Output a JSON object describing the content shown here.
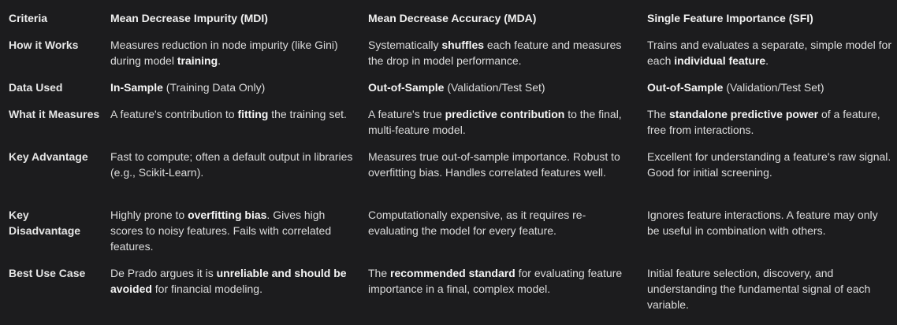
{
  "header": [
    "Criteria",
    "Mean Decrease Impurity (MDI)",
    "Mean Decrease Accuracy (MDA)",
    "Single Feature Importance (SFI)"
  ],
  "rows": [
    {
      "criteria": "How it Works",
      "cells": [
        [
          {
            "t": "Measures reduction in node impurity (like Gini) during model "
          },
          {
            "t": "training",
            "b": true
          },
          {
            "t": "."
          }
        ],
        [
          {
            "t": "Systematically "
          },
          {
            "t": "shuffles",
            "b": true
          },
          {
            "t": " each feature and measures the drop in model performance."
          }
        ],
        [
          {
            "t": "Trains and evaluates a separate, simple model for each "
          },
          {
            "t": "individual feature",
            "b": true
          },
          {
            "t": "."
          }
        ]
      ]
    },
    {
      "criteria": "Data Used",
      "cells": [
        [
          {
            "t": "In-Sample",
            "b": true
          },
          {
            "t": " (Training Data Only)"
          }
        ],
        [
          {
            "t": "Out-of-Sample",
            "b": true
          },
          {
            "t": " (Validation/Test Set)"
          }
        ],
        [
          {
            "t": "Out-of-Sample",
            "b": true
          },
          {
            "t": " (Validation/Test Set)"
          }
        ]
      ]
    },
    {
      "criteria": "What it Measures",
      "cells": [
        [
          {
            "t": "A feature's contribution to "
          },
          {
            "t": "fitting",
            "b": true
          },
          {
            "t": " the training set."
          }
        ],
        [
          {
            "t": "A feature's true "
          },
          {
            "t": "predictive contribution",
            "b": true
          },
          {
            "t": " to the final, multi-feature model."
          }
        ],
        [
          {
            "t": "The "
          },
          {
            "t": "standalone predictive power",
            "b": true
          },
          {
            "t": " of a feature, free from interactions."
          }
        ]
      ]
    },
    {
      "criteria": "Key Advantage",
      "cells": [
        [
          {
            "t": "Fast to compute; often a default output in libraries (e.g., Scikit-Learn)."
          }
        ],
        [
          {
            "t": "Measures true out-of-sample importance. Robust to overfitting bias. Handles correlated features well."
          }
        ],
        [
          {
            "t": "Excellent for understanding a feature's raw signal. Good for initial screening."
          }
        ]
      ]
    },
    {
      "criteria": "Key Disadvantage",
      "cells": [
        [
          {
            "t": "Highly prone to "
          },
          {
            "t": "overfitting bias",
            "b": true
          },
          {
            "t": ". Gives high scores to noisy features. Fails with correlated features."
          }
        ],
        [
          {
            "t": "Computationally expensive, as it requires re-evaluating the model for every feature."
          }
        ],
        [
          {
            "t": "Ignores feature interactions. A feature may only be useful in combination with others."
          }
        ]
      ]
    },
    {
      "criteria": "Best Use Case",
      "cells": [
        [
          {
            "t": "De Prado argues it is "
          },
          {
            "t": "unreliable and should be avoided",
            "b": true
          },
          {
            "t": " for financial modeling."
          }
        ],
        [
          {
            "t": "The "
          },
          {
            "t": "recommended standard",
            "b": true
          },
          {
            "t": " for evaluating feature importance in a final, complex model."
          }
        ],
        [
          {
            "t": "Initial feature selection, discovery, and understanding the fundamental signal of each variable."
          }
        ]
      ]
    }
  ]
}
